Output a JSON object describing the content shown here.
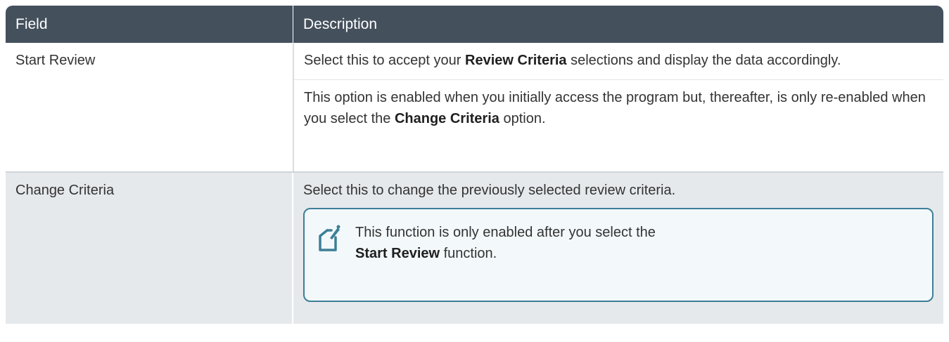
{
  "header": {
    "field": "Field",
    "description": "Description"
  },
  "rows": [
    {
      "field": "Start Review",
      "para1_pre": "Select this to accept your ",
      "para1_bold": "Review Criteria",
      "para1_post": " selections and display the data accordingly.",
      "para2_pre": "This option is enabled when you initially access the program but, thereafter, is only re-enabled when you select the ",
      "para2_bold": "Change Criteria",
      "para2_post": " option."
    },
    {
      "field": "Change Criteria",
      "para1": "Select this to change the previously selected review criteria.",
      "note": {
        "icon": "note-edit-icon",
        "line1": "This function is only enabled after you select the",
        "bold": "Start Review",
        "post": " function."
      }
    }
  ],
  "colors": {
    "header_bg": "#44505c",
    "alt_row_bg": "#e6e9ec",
    "note_border": "#3c7f96"
  }
}
